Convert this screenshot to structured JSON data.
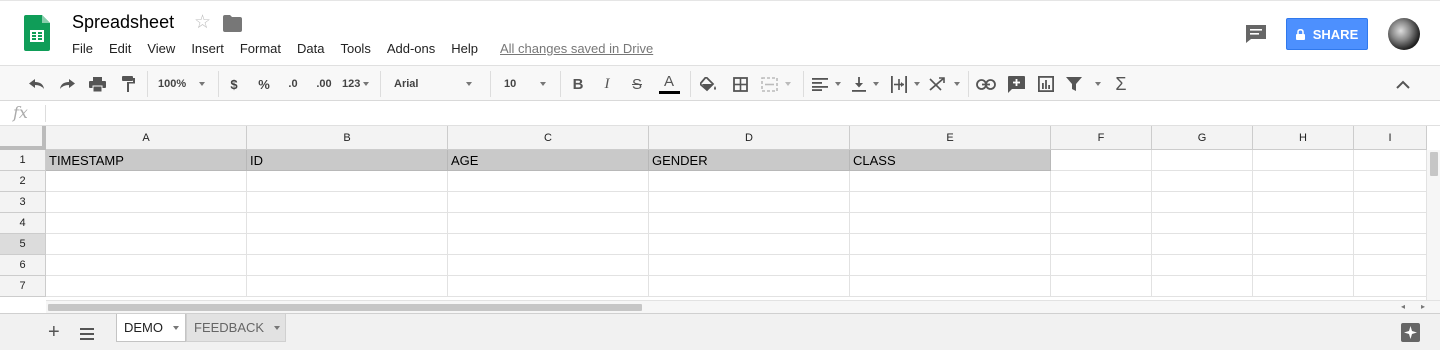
{
  "app": {
    "title": "Spreadsheet",
    "menu": [
      "File",
      "Edit",
      "View",
      "Insert",
      "Format",
      "Data",
      "Tools",
      "Add-ons",
      "Help"
    ],
    "save_status": "All changes saved in Drive",
    "share_label": "SHARE"
  },
  "toolbar": {
    "zoom": "100%",
    "currency": "$",
    "percent": "%",
    "decrease_decimal": ".0",
    "increase_decimal": ".00",
    "more_formats": "123",
    "font": "Arial",
    "font_size": "10"
  },
  "formula_bar": {
    "fx": "fx",
    "value": ""
  },
  "grid": {
    "columns": [
      "A",
      "B",
      "C",
      "D",
      "E",
      "F",
      "G",
      "H",
      "I"
    ],
    "rows": [
      "1",
      "2",
      "3",
      "4",
      "5",
      "6",
      "7"
    ],
    "selected_row": "5",
    "header_cells": [
      "TIMESTAMP",
      "ID",
      "AGE",
      "GENDER",
      "CLASS"
    ]
  },
  "sheets": {
    "tabs": [
      "DEMO",
      "FEEDBACK"
    ],
    "active": "DEMO"
  },
  "colors": {
    "accent": "#4d90fe",
    "logo_green": "#0f9d58",
    "header_fill": "#c9c9c9"
  },
  "icons": [
    "sheets-logo-icon",
    "star-icon",
    "folder-icon",
    "comments-icon",
    "lock-icon",
    "undo-icon",
    "redo-icon",
    "print-icon",
    "paint-format-icon",
    "bold-icon",
    "italic-icon",
    "strikethrough-icon",
    "text-color-icon",
    "fill-color-icon",
    "borders-icon",
    "merge-icon",
    "align-icon",
    "valign-icon",
    "wrap-icon",
    "rotate-icon",
    "link-icon",
    "comment-icon",
    "chart-icon",
    "filter-icon",
    "functions-icon",
    "collapse-icon",
    "add-sheet-icon",
    "all-sheets-icon",
    "explore-icon"
  ]
}
